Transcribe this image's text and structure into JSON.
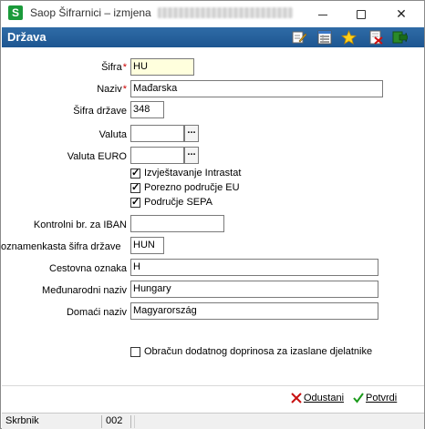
{
  "window": {
    "title": "Saop Šifrarnici – izmjena",
    "app_icon_letter": "S",
    "minimize_icon": "minimize-icon",
    "maximize_icon": "maximize-icon",
    "close_icon": "close-icon"
  },
  "header": {
    "title": "Država",
    "tools": [
      "edit-icon",
      "list-icon",
      "star-icon",
      "delete-icon",
      "exit-icon"
    ]
  },
  "form": {
    "sifra": {
      "label": "Šifra",
      "required_mark": "*",
      "value": "HU"
    },
    "naziv": {
      "label": "Naziv",
      "required_mark": "*",
      "value": "Mađarska"
    },
    "sifra_drzave": {
      "label": "Šifra države",
      "value": "348"
    },
    "valuta": {
      "label": "Valuta",
      "value": "",
      "lookup": "..."
    },
    "valuta_euro": {
      "label": "Valuta EURO",
      "value": "",
      "lookup": "..."
    },
    "checkboxes": [
      {
        "label": "Izvještavanje Intrastat",
        "checked": true
      },
      {
        "label": "Porezno područje EU",
        "checked": true
      },
      {
        "label": "Područje SEPA",
        "checked": true
      }
    ],
    "kontrolni": {
      "label": "Kontrolni br. za  IBAN",
      "value": ""
    },
    "troznamenkasta": {
      "label": "oznamenkasta šifra države",
      "value": "HUN"
    },
    "cestovna": {
      "label": "Cestovna oznaka",
      "value": "H"
    },
    "medunarodni": {
      "label": "Međunarodni naziv",
      "value": "Hungary"
    },
    "domaci": {
      "label": "Domaći naziv",
      "value": "Magyarország"
    },
    "obracun": {
      "label": "Obračun dodatnog doprinosa za izaslane djelatnike",
      "checked": false
    }
  },
  "buttons": {
    "cancel": "Odustani",
    "ok": "Potvrdi"
  },
  "status": {
    "user": "Skrbnik",
    "code": "002",
    "rest": ""
  },
  "colors": {
    "header_bg": "#1d5691",
    "required": "#cc0000",
    "required_field_bg": "#ffffdd",
    "app_icon": "#1a9a3a"
  }
}
